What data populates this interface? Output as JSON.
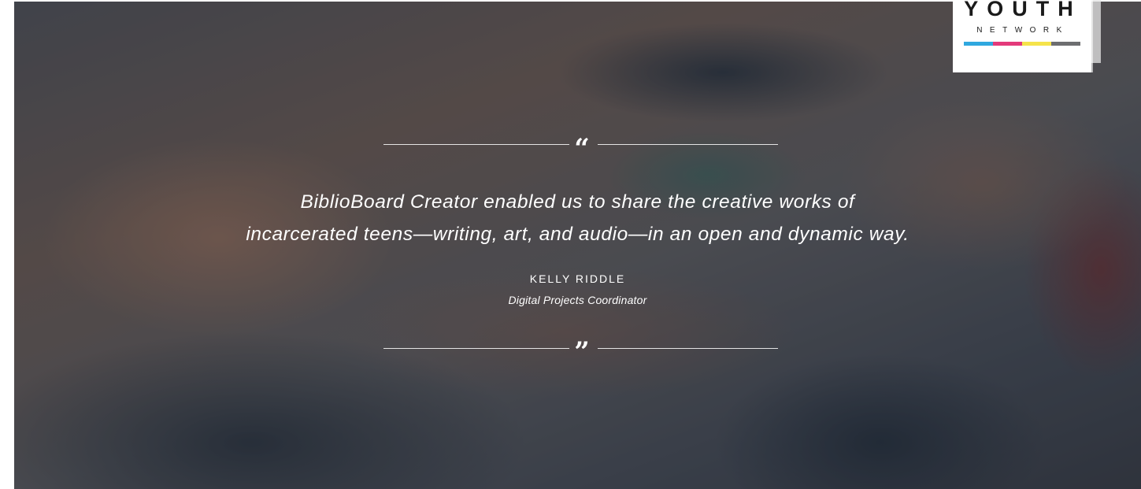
{
  "logo": {
    "word": "YOUTH",
    "sub": "NETWORK",
    "bar_colors": [
      "#2fa8df",
      "#e33a7b",
      "#f5e34a",
      "#6d6e70"
    ]
  },
  "testimonial": {
    "open_mark": "“",
    "close_mark": "”",
    "quote_line_1": "BiblioBoard Creator enabled us to share the creative works of",
    "quote_line_2": "incarcerated teens—writing, art, and audio—in an open and dynamic way.",
    "author": "KELLY RIDDLE",
    "role": "Digital Projects Coordinator"
  }
}
